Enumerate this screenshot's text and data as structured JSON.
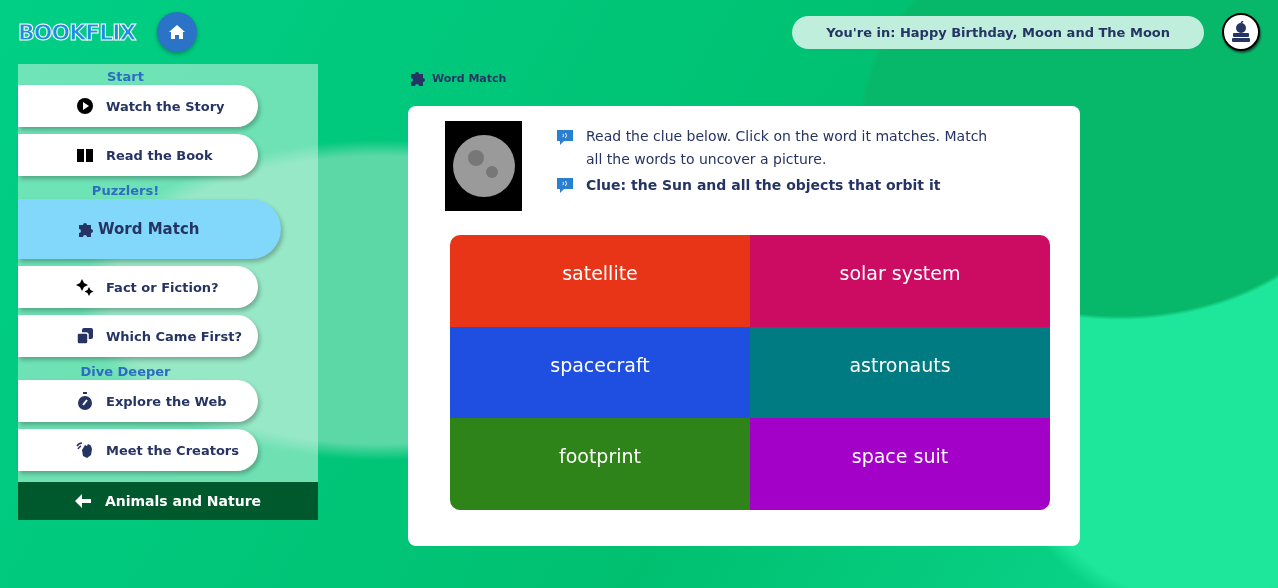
{
  "header": {
    "logo": "BOOKFLIX",
    "location": "You're in: Happy Birthday, Moon and The Moon"
  },
  "sidebar": {
    "sections": [
      {
        "heading": "Start",
        "items": [
          {
            "label": "Watch the Story",
            "selected": false
          },
          {
            "label": "Read the Book",
            "selected": false
          }
        ]
      },
      {
        "heading": "Puzzlers!",
        "items": [
          {
            "label": "Word Match",
            "selected": true
          },
          {
            "label": "Fact or Fiction?",
            "selected": false
          },
          {
            "label": "Which Came First?",
            "selected": false
          }
        ]
      },
      {
        "heading": "Dive Deeper",
        "items": [
          {
            "label": "Explore the Web",
            "selected": false
          },
          {
            "label": "Meet the Creators",
            "selected": false
          }
        ]
      }
    ],
    "back_link": "Animals and Nature"
  },
  "game": {
    "title": "Word Match",
    "instructions": "Read the clue below. Click on the word it matches. Match all the words to uncover a picture.",
    "clue": "Clue: the Sun and all the objects that orbit it",
    "tiles": [
      {
        "word": "satellite",
        "color": "#e83518"
      },
      {
        "word": "solar system",
        "color": "#cc0b62"
      },
      {
        "word": "spacecraft",
        "color": "#1f4fe0"
      },
      {
        "word": "astronauts",
        "color": "#007b82"
      },
      {
        "word": "footprint",
        "color": "#2e8419"
      },
      {
        "word": "space suit",
        "color": "#a300c8"
      }
    ]
  }
}
